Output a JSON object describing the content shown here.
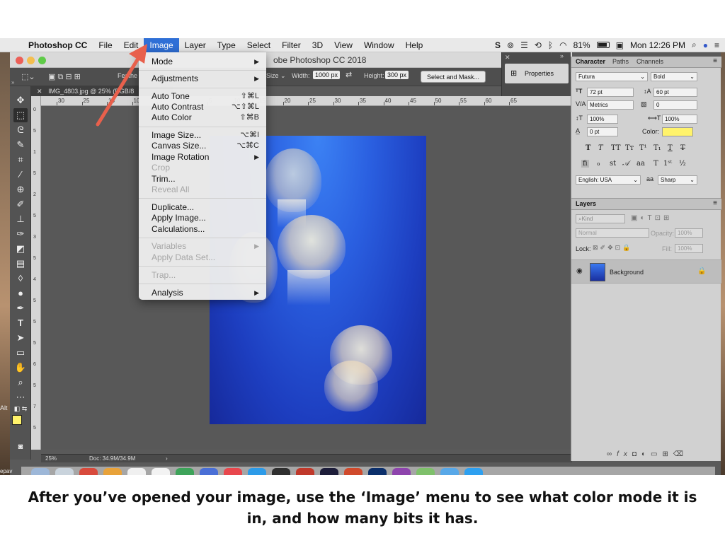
{
  "menubar": {
    "app_name": "Photoshop CC",
    "items": [
      "File",
      "Edit",
      "Image",
      "Layer",
      "Type",
      "Select",
      "Filter",
      "3D",
      "View",
      "Window",
      "Help"
    ],
    "battery": "81%",
    "clock": "Mon 12:26 PM"
  },
  "window": {
    "title": "obe Photoshop CC 2018",
    "doc_tab": "IMG_4803.jpg @ 25% (RGB/8"
  },
  "options_bar": {
    "feather_label": "Feathe",
    "size_label": "Size",
    "width_label": "Width:",
    "width_value": "1000 px",
    "height_label": "Height:",
    "height_value": "300 px",
    "select_mask_button": "Select and Mask..."
  },
  "properties_button": "Properties",
  "ruler_h_labels": [
    "30",
    "25",
    "15",
    "10",
    "5",
    "0",
    "5",
    "10",
    "15",
    "20",
    "25",
    "30",
    "35",
    "40",
    "45",
    "50",
    "55",
    "60",
    "65"
  ],
  "ruler_v_labels": [
    "0",
    "5",
    "1",
    "5",
    "2",
    "5",
    "3",
    "5",
    "4",
    "5",
    "5",
    "5",
    "6",
    "5",
    "7",
    "5"
  ],
  "image_menu": {
    "items": [
      {
        "label": "Mode",
        "submenu": true
      },
      {
        "label": "Adjustments",
        "submenu": true
      },
      {
        "label": "Auto Tone",
        "shortcut": "⇧⌘L"
      },
      {
        "label": "Auto Contrast",
        "shortcut": "⌥⇧⌘L"
      },
      {
        "label": "Auto Color",
        "shortcut": "⇧⌘B"
      },
      {
        "label": "Image Size...",
        "shortcut": "⌥⌘I"
      },
      {
        "label": "Canvas Size...",
        "shortcut": "⌥⌘C"
      },
      {
        "label": "Image Rotation",
        "submenu": true
      },
      {
        "label": "Crop",
        "disabled": true
      },
      {
        "label": "Trim..."
      },
      {
        "label": "Reveal All",
        "disabled": true
      },
      {
        "label": "Duplicate..."
      },
      {
        "label": "Apply Image..."
      },
      {
        "label": "Calculations..."
      },
      {
        "label": "Variables",
        "submenu": true,
        "disabled": true
      },
      {
        "label": "Apply Data Set...",
        "disabled": true
      },
      {
        "label": "Trap...",
        "disabled": true
      },
      {
        "label": "Analysis",
        "submenu": true
      }
    ]
  },
  "character_panel": {
    "tabs": [
      "Character",
      "Paths",
      "Channels"
    ],
    "font_family": "Futura",
    "font_style": "Bold",
    "font_size": "72 pt",
    "leading": "60 pt",
    "kerning": "Metrics",
    "tracking": "0",
    "vertical_scale": "100%",
    "horizontal_scale": "100%",
    "baseline_shift": "0 pt",
    "color_label": "Color:",
    "color_value": "#fff36b",
    "language": "English: USA",
    "antialias": "Sharp",
    "aa_label": "aa"
  },
  "layers_panel": {
    "title": "Layers",
    "filter": "Kind",
    "blend_mode": "Normal",
    "opacity_label": "Opacity:",
    "opacity_value": "100%",
    "lock_label": "Lock:",
    "fill_label": "Fill:",
    "fill_value": "100%",
    "layer_name": "Background"
  },
  "status_bar": {
    "zoom": "25%",
    "doc_info": "Doc: 34.9M/34.9M"
  },
  "side_fragments": {
    "left_alt": "Alt",
    "left_bottom": "epav"
  },
  "caption": "After you’ve opened your image, use the ‘Image’ menu to see what color mode it is in, and how many bits it has."
}
